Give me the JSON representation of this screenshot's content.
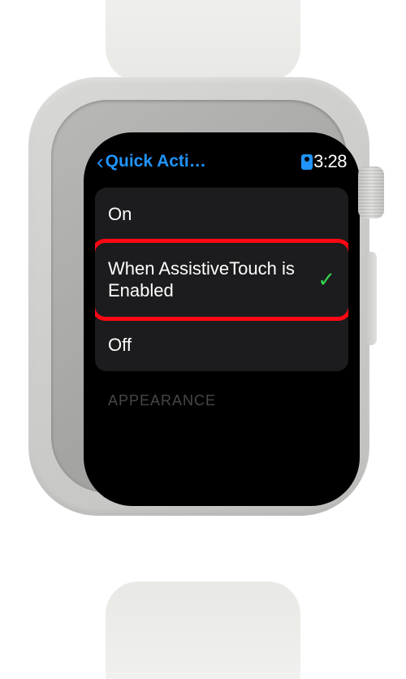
{
  "nav": {
    "back_label": "Quick Acti…"
  },
  "status": {
    "time": "3:28"
  },
  "options": [
    {
      "label": "On",
      "selected": false
    },
    {
      "label": "When Assistive­Touch is Enabled",
      "selected": true
    },
    {
      "label": "Off",
      "selected": false
    }
  ],
  "section_header": "APPEARANCE",
  "highlighted_index": 1
}
